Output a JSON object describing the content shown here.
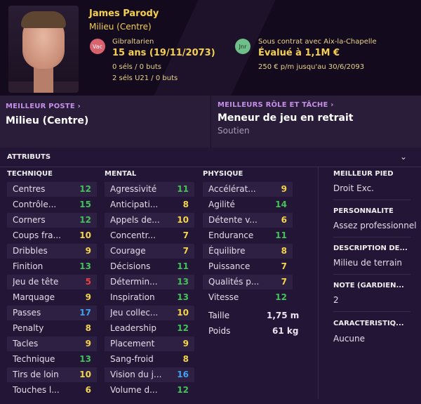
{
  "header": {
    "name": "James Parody",
    "position": "Milieu (Centre)",
    "badge_left": "Vac",
    "nationality": "Gibraltarien",
    "age": "15 ans (19/11/2073)",
    "caps": "0 séls / 0 buts",
    "caps_u21": "2 séls U21 / 0 buts",
    "badge_right": "Jnr",
    "contract": "Sous contrat avec Aix-la-Chapelle",
    "value": "Évalué à 1,1M €",
    "wage": "250 € p/m jusqu'au 30/6/2093"
  },
  "best": {
    "position_title": "MEILLEUR POSTE",
    "position_value": "Milieu (Centre)",
    "role_title": "MEILLEURS RÔLE ET TÂCHE",
    "role_value": "Meneur de jeu en retrait",
    "role_duty": "Soutien"
  },
  "attributes": {
    "title": "ATTRIBUTS",
    "technique_title": "TECHNIQUE",
    "mental_title": "MENTAL",
    "physique_title": "PHYSIQUE",
    "technique": [
      {
        "label": "Centres",
        "value": "12"
      },
      {
        "label": "Contrôle...",
        "value": "15"
      },
      {
        "label": "Corners",
        "value": "12"
      },
      {
        "label": "Coups fra...",
        "value": "10"
      },
      {
        "label": "Dribbles",
        "value": "9"
      },
      {
        "label": "Finition",
        "value": "13"
      },
      {
        "label": "Jeu de tête",
        "value": "5"
      },
      {
        "label": "Marquage",
        "value": "9"
      },
      {
        "label": "Passes",
        "value": "17"
      },
      {
        "label": "Penalty",
        "value": "8"
      },
      {
        "label": "Tacles",
        "value": "9"
      },
      {
        "label": "Technique",
        "value": "13"
      },
      {
        "label": "Tirs de loin",
        "value": "10"
      },
      {
        "label": "Touches l...",
        "value": "6"
      }
    ],
    "mental": [
      {
        "label": "Agressivité",
        "value": "11"
      },
      {
        "label": "Anticipati...",
        "value": "8"
      },
      {
        "label": "Appels de...",
        "value": "10"
      },
      {
        "label": "Concentr...",
        "value": "7"
      },
      {
        "label": "Courage",
        "value": "7"
      },
      {
        "label": "Décisions",
        "value": "11"
      },
      {
        "label": "Détermin...",
        "value": "13"
      },
      {
        "label": "Inspiration",
        "value": "13"
      },
      {
        "label": "Jeu collec...",
        "value": "10"
      },
      {
        "label": "Leadership",
        "value": "12"
      },
      {
        "label": "Placement",
        "value": "9"
      },
      {
        "label": "Sang-froid",
        "value": "8"
      },
      {
        "label": "Vision du j...",
        "value": "16"
      },
      {
        "label": "Volume d...",
        "value": "12"
      }
    ],
    "physique": [
      {
        "label": "Accélérat...",
        "value": "9"
      },
      {
        "label": "Agilité",
        "value": "14"
      },
      {
        "label": "Détente v...",
        "value": "6"
      },
      {
        "label": "Endurance",
        "value": "11"
      },
      {
        "label": "Équilibre",
        "value": "8"
      },
      {
        "label": "Puissance",
        "value": "7"
      },
      {
        "label": "Qualités p...",
        "value": "7"
      },
      {
        "label": "Vitesse",
        "value": "12"
      }
    ],
    "height_label": "Taille",
    "height_value": "1,75 m",
    "weight_label": "Poids",
    "weight_value": "61 kg"
  },
  "side": {
    "foot_title": "MEILLEUR PIED",
    "foot_value": "Droit Exc.",
    "personality_title": "PERSONNALITÉ",
    "personality_value": "Assez professionnel",
    "description_title": "DESCRIPTION DE...",
    "description_value": "Milieu de terrain",
    "note_title": "NOTE (GARDIEN...",
    "note_value": "2",
    "features_title": "CARACTÉRISTIQ...",
    "features_value": "Aucune"
  },
  "colors": {
    "accent": "#f5d04f",
    "high": "#44c25a",
    "mid": "#f5d54a",
    "low": "#ee3f3f",
    "top": "#3fa2f0"
  }
}
